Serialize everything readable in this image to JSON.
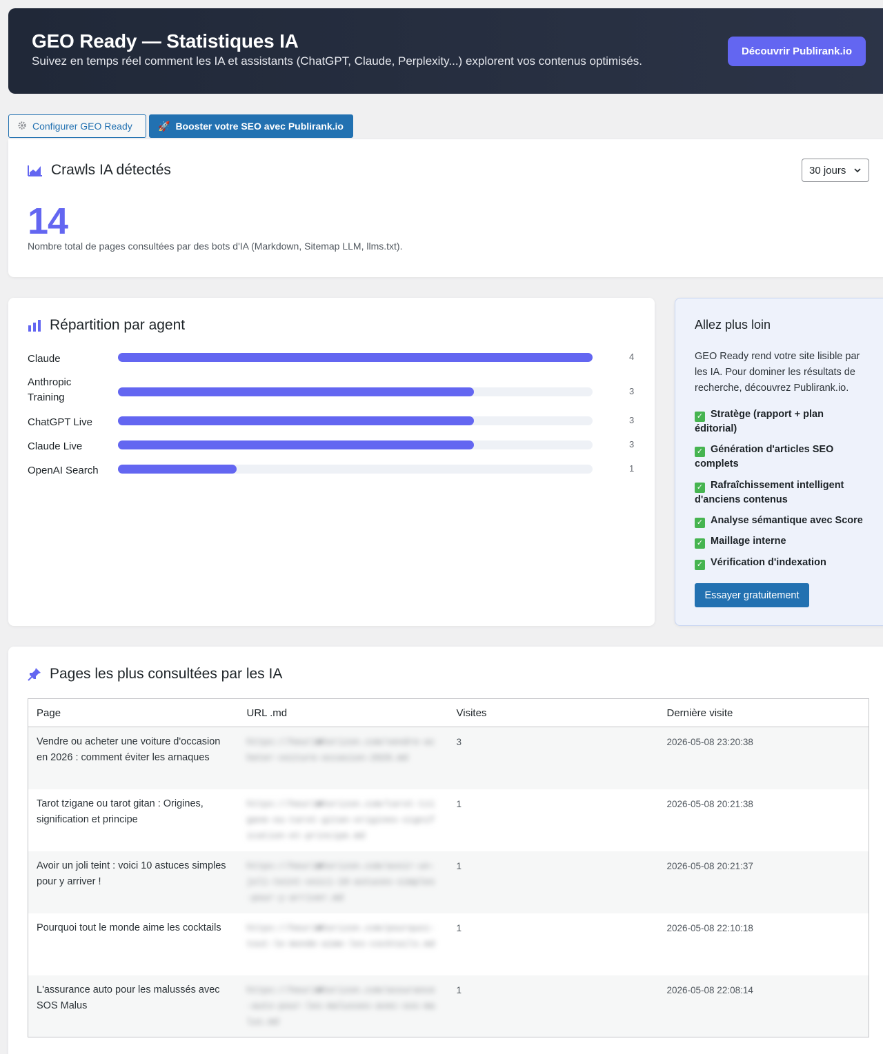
{
  "header": {
    "title": "GEO Ready — Statistiques IA",
    "subtitle": "Suivez en temps réel comment les IA et assistants (ChatGPT, Claude, Perplexity...) explorent vos contenus optimisés.",
    "cta_label": "Découvrir Publirank.io"
  },
  "tabs": {
    "configure_label": "Configurer GEO Ready",
    "boost_label": "Booster votre SEO avec Publirank.io"
  },
  "crawls": {
    "title": "Crawls IA détectés",
    "period": "30 jours",
    "total": "14",
    "description": "Nombre total de pages consultées par des bots d'IA (Markdown, Sitemap LLM, llms.txt)."
  },
  "agents": {
    "title": "Répartition par agent",
    "max": 4,
    "items": [
      {
        "name": "Claude",
        "count": 4
      },
      {
        "name": "Anthropic Training",
        "count": 3
      },
      {
        "name": "ChatGPT Live",
        "count": 3
      },
      {
        "name": "Claude Live",
        "count": 3
      },
      {
        "name": "OpenAI Search",
        "count": 1
      }
    ]
  },
  "promo": {
    "title": "Allez plus loin",
    "text": "GEO Ready rend votre site lisible par les IA. Pour dominer les résultats de recherche, découvrez Publirank.io.",
    "features": [
      "Stratège (rapport + plan éditorial)",
      "Génération d'articles SEO complets",
      "Rafraîchissement intelligent d'anciens contenus",
      "Analyse sémantique avec Score",
      "Maillage interne",
      "Vérification d'indexation"
    ],
    "cta_label": "Essayer gratuitement"
  },
  "pages": {
    "title": "Pages les plus consultées par les IA",
    "columns": [
      "Page",
      "URL .md",
      "Visites",
      "Dernière visite"
    ],
    "rows": [
      {
        "page": "Vendre ou acheter une voiture d'occasion en 2026 : comment éviter les arnaques",
        "url": "https://heuri■horizon.com/vendre-acheter-voiture-occasion-2026.md",
        "visits": "3",
        "last": "2026-05-08 23:20:38"
      },
      {
        "page": "Tarot tzigane ou tarot gitan : Origines, signification et principe",
        "url": "https://heuri■horizon.com/tarot-tzigane-ou-tarot-gitan-origines-signification-et-principe.md",
        "visits": "1",
        "last": "2026-05-08 20:21:38"
      },
      {
        "page": "Avoir un joli teint : voici 10 astuces simples pour y arriver !",
        "url": "https://heuri■horizon.com/avoir-un-joli-teint-voici-10-astuces-simples-pour-y-arriver.md",
        "visits": "1",
        "last": "2026-05-08 20:21:37"
      },
      {
        "page": "Pourquoi tout le monde aime les cocktails",
        "url": "https://heuri■horizon.com/pourquoi-tout-le-monde-aime-les-cocktails.md",
        "visits": "1",
        "last": "2026-05-08 22:10:18"
      },
      {
        "page": "L'assurance auto pour les malussés avec SOS Malus",
        "url": "https://heuri■horizon.com/assurance-auto-pour-les-malusses-avec-sos-malus.md",
        "visits": "1",
        "last": "2026-05-08 22:08:14"
      }
    ]
  },
  "colors": {
    "accent": "#6366f1",
    "wp_blue": "#2271b1",
    "hero_bg": "#202838",
    "check_green": "#46b450"
  },
  "icons": {
    "crawls": "area-chart-icon",
    "agents": "bar-chart-icon",
    "pages": "pushpin-icon",
    "configure": "gear-icon",
    "boost": "rocket-icon"
  }
}
